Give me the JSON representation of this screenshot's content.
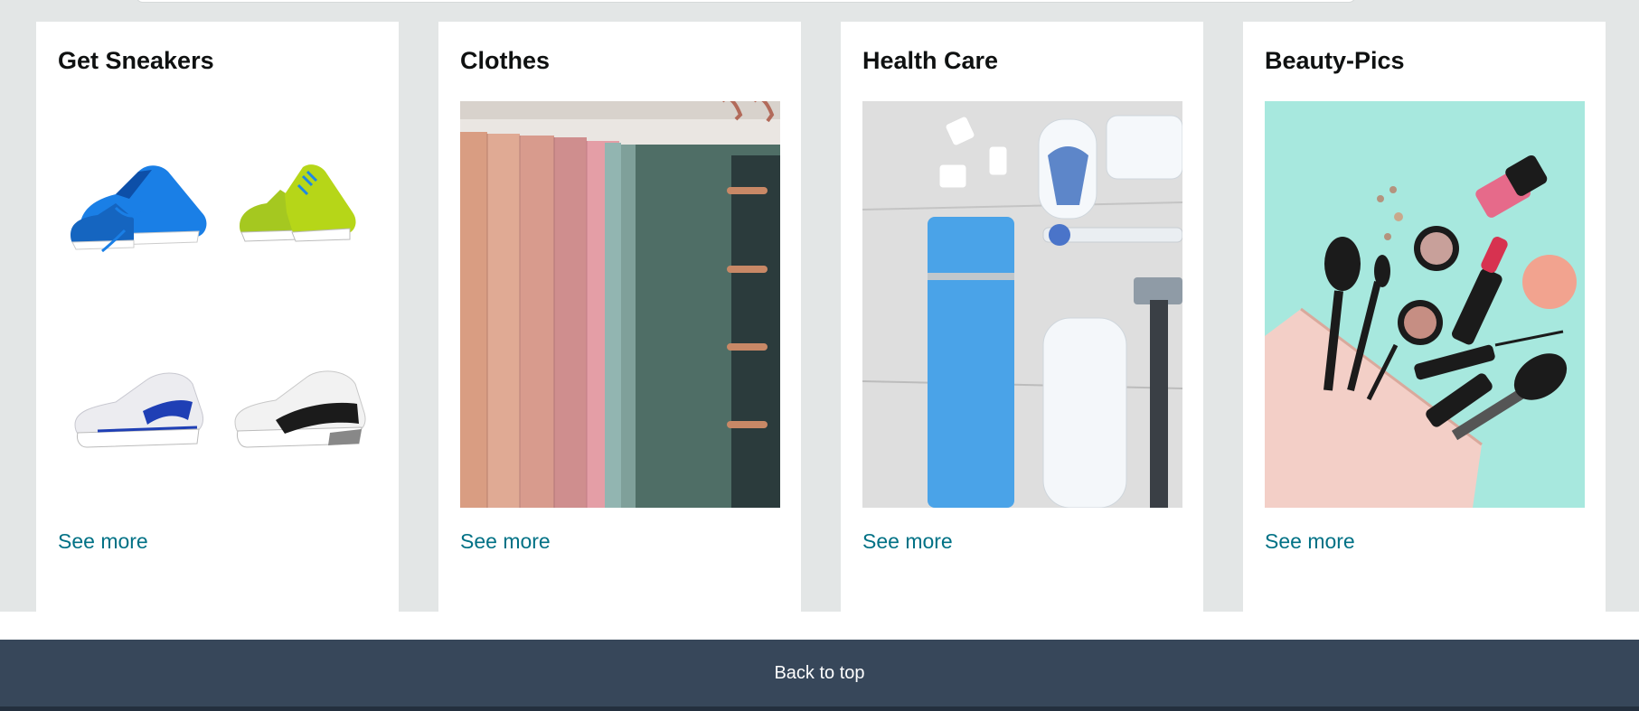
{
  "cards": [
    {
      "title": "Get Sneakers",
      "link": "See more",
      "image": "sneakers-grid"
    },
    {
      "title": "Clothes",
      "link": "See more",
      "image": "hanging-scarves"
    },
    {
      "title": "Health Care",
      "link": "See more",
      "image": "toiletries-flatlay"
    },
    {
      "title": "Beauty-Pics",
      "link": "See more",
      "image": "makeup-bag"
    }
  ],
  "footer": {
    "back_to_top": "Back to top"
  },
  "colors": {
    "page_bg": "#e3e6e6",
    "link": "#007185",
    "footer_nav": "#37475a",
    "footer_dark": "#232f3e"
  }
}
